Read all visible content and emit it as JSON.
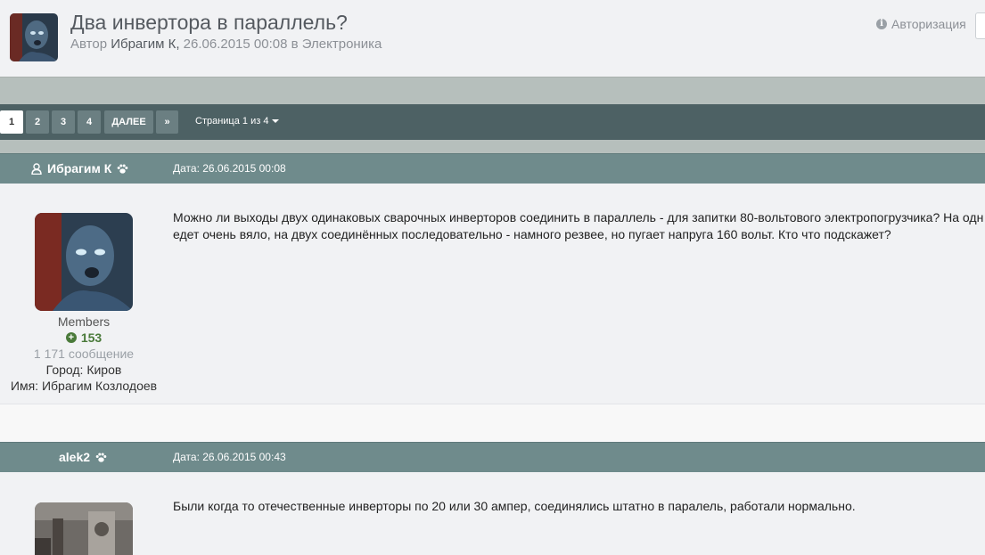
{
  "topic": {
    "title": "Два инвертора в параллель?",
    "author_prefix": "Автор",
    "author": "Ибрагим К,",
    "date": "26.06.2015 00:08",
    "forum_prefix": "в",
    "forum": "Электроника"
  },
  "header": {
    "login_label": "Авторизация",
    "login_icon": "info-icon"
  },
  "pagination": {
    "pages": [
      "1",
      "2",
      "3",
      "4"
    ],
    "current": "1",
    "next_label": "ДАЛЕЕ",
    "last_label": "»",
    "page_of_label": "Страница 1 из 4"
  },
  "posts": [
    {
      "author": "Ибрагим К",
      "date": "Дата: 26.06.2015 00:08",
      "text_line1": "Можно ли выходы двух одинаковых сварочных инверторов соединить в параллель - для запитки 80-вольтового электропогрузчика? На одн",
      "text_line2": "едет очень вяло, на двух соединённых последовательно - намного резвее, но пугает напруга 160 вольт. Кто что подскажет?",
      "group": "Members",
      "reputation": "153",
      "posts_count": "1 171 сообщение",
      "city": "Город: Киров",
      "name": "Имя: Ибрагим Козлодоев"
    },
    {
      "author": "alek2",
      "date": "Дата: 26.06.2015 00:43",
      "text_line1": "Были когда то отечественные инверторы по 20 или 30 ампер, соединялись штатно в паралель, работали нормально."
    }
  ],
  "colors": {
    "post_header": "#6f8b8c",
    "pager_bar": "#4d6164",
    "reputation": "#4a7a3a"
  }
}
